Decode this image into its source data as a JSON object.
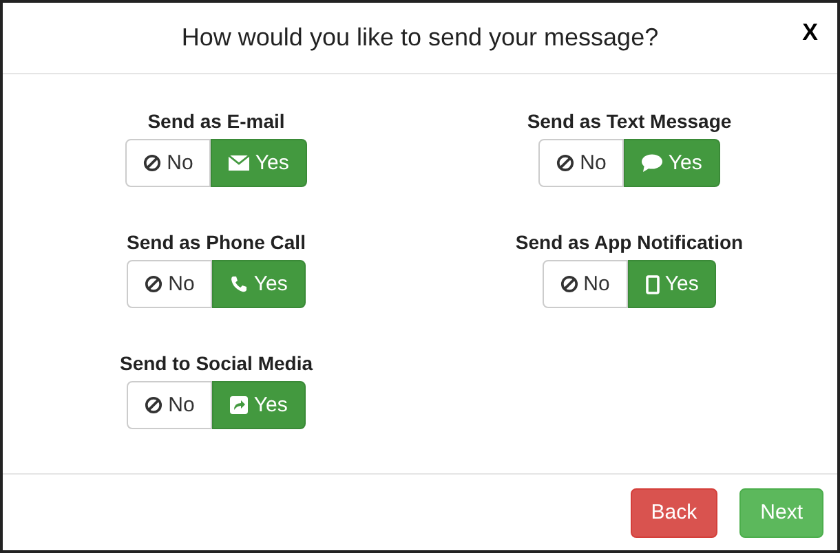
{
  "dialog": {
    "title": "How would you like to send your message?",
    "close": "X"
  },
  "options": [
    {
      "label": "Send as E-mail",
      "kind": "email",
      "choices": [
        {
          "text": "No",
          "selected": false
        },
        {
          "text": "Yes",
          "selected": true
        }
      ]
    },
    {
      "label": "Send as Text Message",
      "kind": "sms",
      "choices": [
        {
          "text": "No",
          "selected": false
        },
        {
          "text": "Yes",
          "selected": true
        }
      ]
    },
    {
      "label": "Send as Phone Call",
      "kind": "phone",
      "choices": [
        {
          "text": "No",
          "selected": false
        },
        {
          "text": "Yes",
          "selected": true
        }
      ]
    },
    {
      "label": "Send as App Notification",
      "kind": "app",
      "choices": [
        {
          "text": "No",
          "selected": false
        },
        {
          "text": "Yes",
          "selected": true
        }
      ]
    },
    {
      "label": "Send to Social Media",
      "kind": "social",
      "choices": [
        {
          "text": "No",
          "selected": false
        },
        {
          "text": "Yes",
          "selected": true
        }
      ]
    }
  ],
  "footer": {
    "buttons": [
      {
        "label": "Back",
        "kind": "danger"
      },
      {
        "label": "Next",
        "kind": "success"
      }
    ]
  }
}
